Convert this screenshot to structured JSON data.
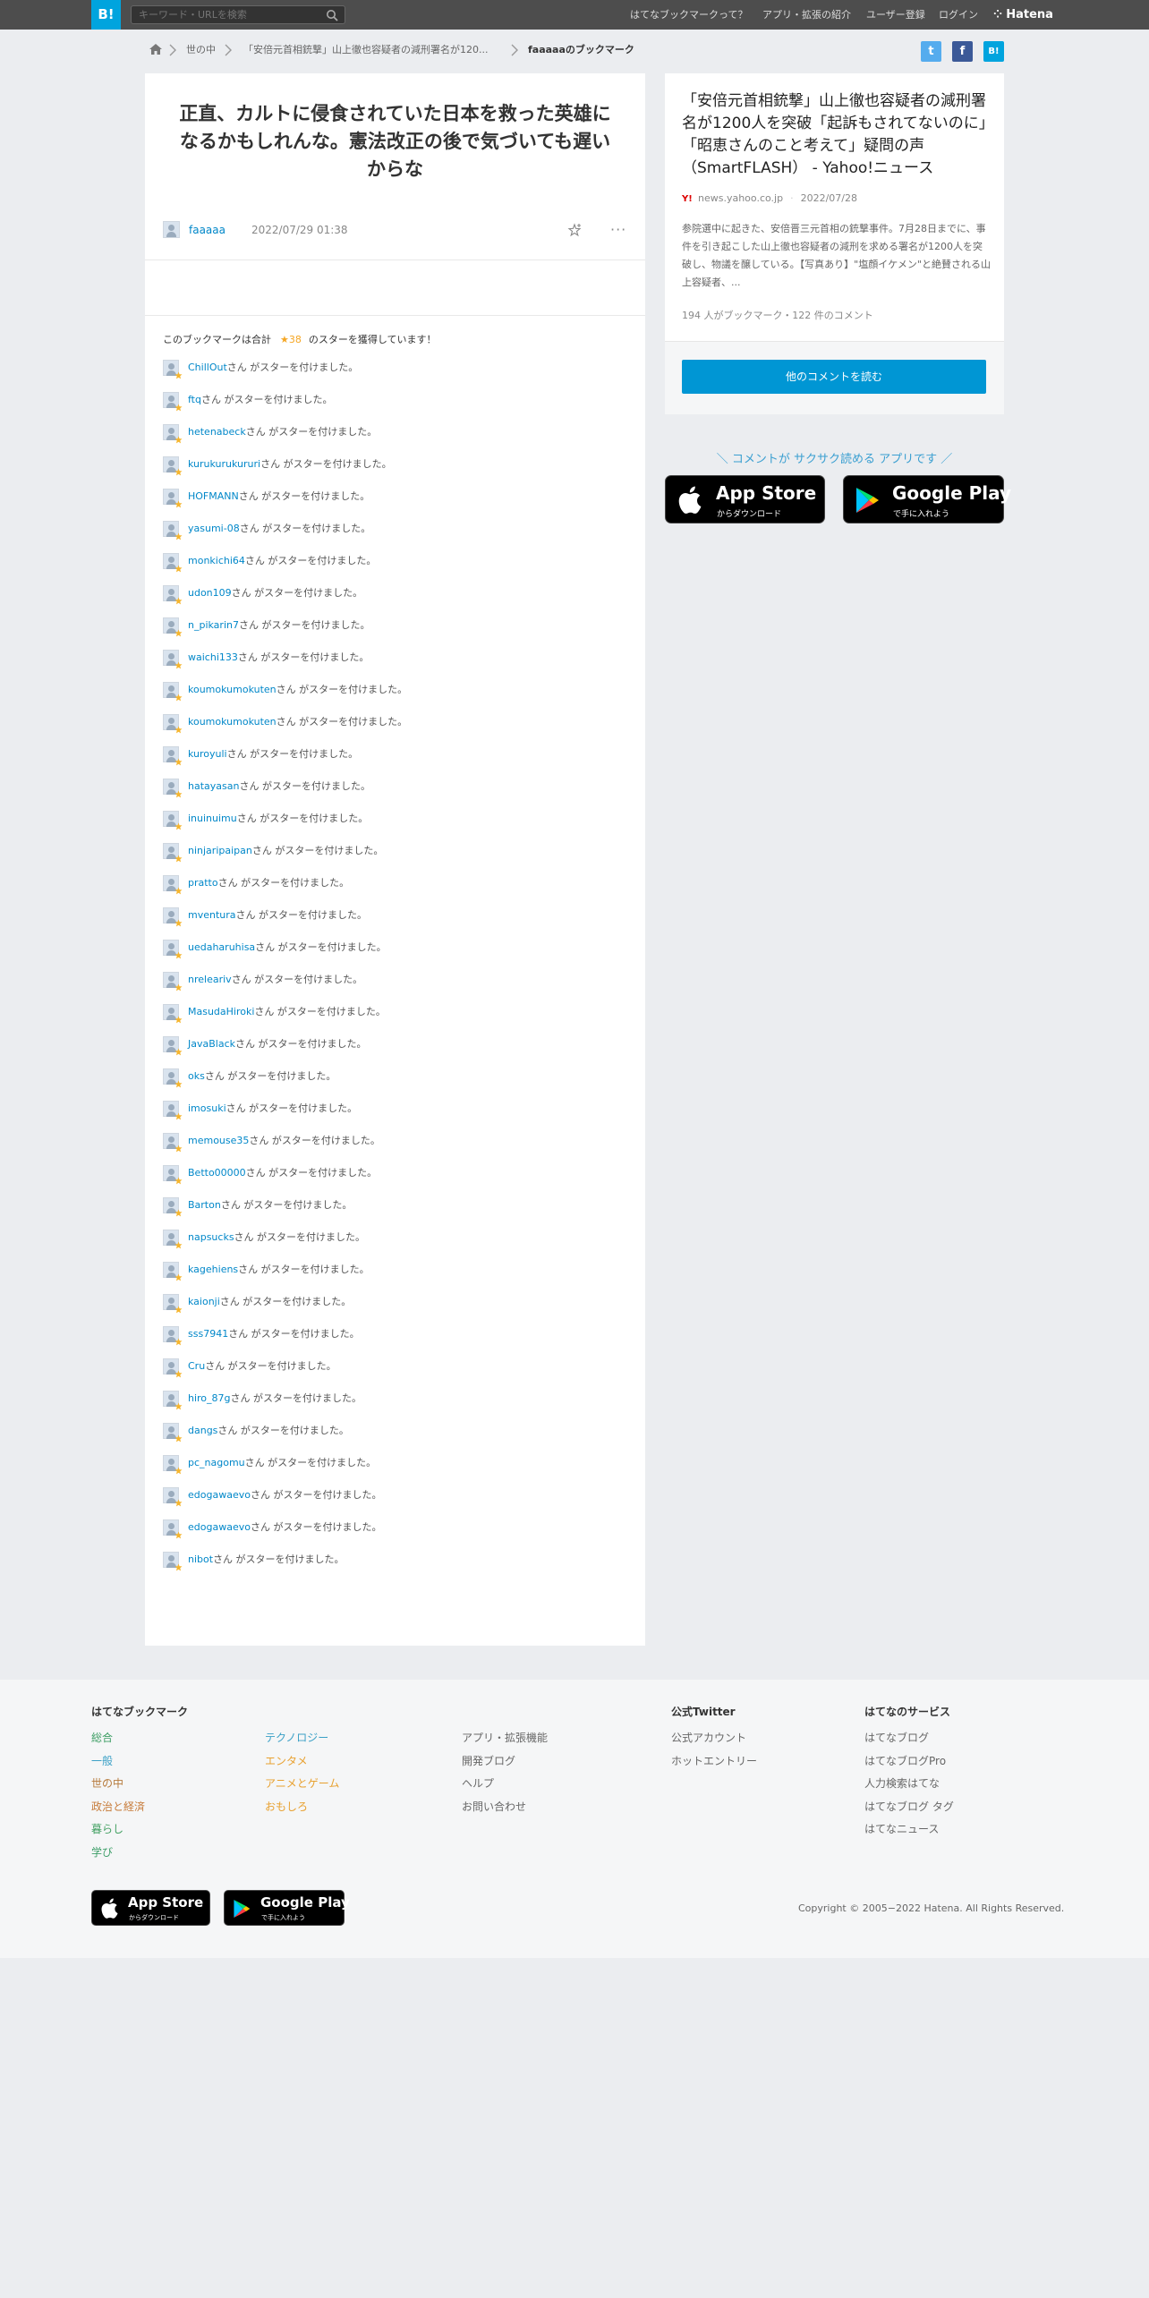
{
  "header": {
    "logo": "B!",
    "search_placeholder": "キーワード・URLを検索",
    "nav": [
      "はてなブックマークって？",
      "アプリ・拡張の紹介",
      "ユーザー登録",
      "ログイン"
    ],
    "brand": "Hatena"
  },
  "breadcrumb": {
    "items": [
      "世の中",
      "「安倍元首相銃撃」山上徹也容疑者の減刑署名が120..."
    ],
    "current": "faaaaaのブックマーク"
  },
  "share": {
    "twitter": "t",
    "facebook": "f",
    "hatena": "B!"
  },
  "comment": {
    "text": "正直、カルトに侵食されていた日本を救った英雄になるかもしれんな。憲法改正の後で気づいても遅いからな",
    "user": "faaaaa",
    "date": "2022/07/29 01:38",
    "more": "···"
  },
  "stars": {
    "prefix": "このブックマークは合計",
    "count": "★38",
    "suffix": "のスターを獲得しています！",
    "suffix_text": "さん がスターを付けました。",
    "users": [
      "ChillOut",
      "ftq",
      "hetenabeck",
      "kurukurukururi",
      "HOFMANN",
      "yasumi-08",
      "monkichi64",
      "udon109",
      "n_pikarin7",
      "waichi133",
      "koumokumokuten",
      "koumokumokuten",
      "kuroyuli",
      "hatayasan",
      "inuinuimu",
      "ninjaripaipan",
      "pratto",
      "mventura",
      "uedaharuhisa",
      "nreleariv",
      "MasudaHiroki",
      "JavaBlack",
      "oks",
      "imosuki",
      "memouse35",
      "Betto00000",
      "Barton",
      "napsucks",
      "kagehiens",
      "kaionji",
      "sss7941",
      "Cru",
      "hiro_87g",
      "dangs",
      "pc_nagomu",
      "edogawaevo",
      "edogawaevo",
      "nibot"
    ]
  },
  "article": {
    "title": "「安倍元首相銃撃」山上徹也容疑者の減刑署名が1200人を突破「起訴もされてないのに」「昭恵さんのこと考えて」疑問の声（SmartFLASH） - Yahoo!ニュース",
    "favicon": "Y!",
    "domain": "news.yahoo.co.jp",
    "date": "2022/07/28",
    "description": "参院選中に起きた、安倍晋三元首相の銃撃事件。7月28日までに、事件を引き起こした山上徹也容疑者の減刑を求める署名が1200人を突破し、物議を醸している。【写真あり】\"塩顔イケメン\"と絶賛される山上容疑者、...",
    "meta": "194 人がブックマーク・122 件のコメント",
    "button": "他のコメントを読む"
  },
  "promo": {
    "text": "＼ コメントが サクサク読める アプリです ／",
    "appstore_big": "App Store",
    "appstore_small": "からダウンロード",
    "googleplay_big": "Google Play",
    "googleplay_small": "で手に入れよう"
  },
  "footer": {
    "heading_bookmark": "はてなブックマーク",
    "heading_twitter": "公式Twitter",
    "heading_services": "はてなのサービス",
    "col1": [
      "総合",
      "一般",
      "世の中",
      "政治と経済",
      "暮らし",
      "学び"
    ],
    "col2": [
      "テクノロジー",
      "エンタメ",
      "アニメとゲーム",
      "おもしろ"
    ],
    "col3": [
      "アプリ・拡張機能",
      "開発ブログ",
      "ヘルプ",
      "お問い合わせ"
    ],
    "col4": [
      "公式アカウント",
      "ホットエントリー"
    ],
    "col5": [
      "はてなブログ",
      "はてなブログPro",
      "人力検索はてな",
      "はてなブログ タグ",
      "はてなニュース"
    ],
    "copyright": "Copyright © 2005−2022 Hatena. All Rights Reserved."
  },
  "colors": {
    "col1": [
      "#3d9e64",
      "#3aa0c6",
      "#b67a3c",
      "#c77c3b",
      "#45a164",
      "#3f9f6a"
    ],
    "col2": [
      "#3aa0c6",
      "#e8a130",
      "#e8a130",
      "#e8a130"
    ]
  }
}
